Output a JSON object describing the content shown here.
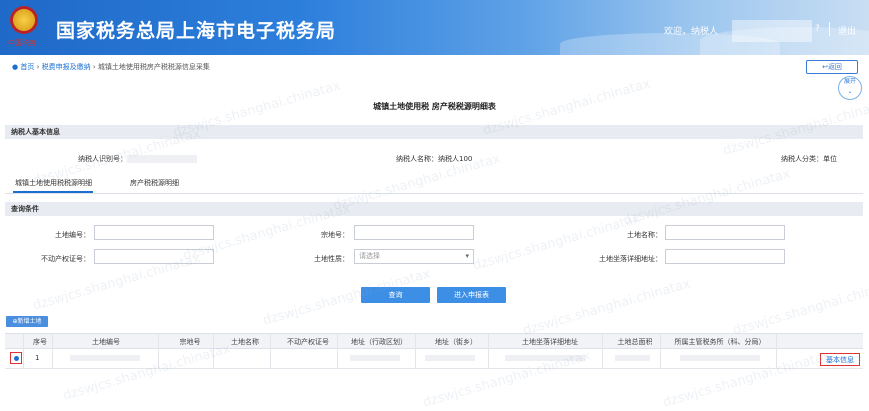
{
  "header": {
    "title": "国家税务总局上海市电子税务局",
    "emblem_caption": "中国税务",
    "greeting": "欢迎，纳税人",
    "help": "?",
    "logout": "退出"
  },
  "breadcrumb": {
    "home": "首页",
    "sep1": "›",
    "level1": "税费申报及缴纳",
    "sep2": "›",
    "current": "城镇土地使用税房产税税源信息采集"
  },
  "actions": {
    "back": "返回",
    "expand": "展开"
  },
  "page_title": "城镇土地使用税 房产税税源明细表",
  "taxpayer": {
    "section_title": "纳税人基本信息",
    "id_label": "纳税人识别号：",
    "name_label": "纳税人名称：",
    "name_value": "纳税人100",
    "category_label": "纳税人分类：",
    "category_value": "单位"
  },
  "tabs": [
    {
      "label": "城镇土地使用税税源明细",
      "active": true
    },
    {
      "label": "房产税税源明细",
      "active": false
    }
  ],
  "query": {
    "section_title": "查询条件",
    "land_no_label": "土地编号：",
    "parcel_no_label": "宗地号：",
    "land_name_label": "土地名称：",
    "property_cert_label": "不动产权证号：",
    "land_nature_label": "土地性质：",
    "land_nature_placeholder": "请选择",
    "land_address_label": "土地坐落详细地址：",
    "query_button": "查询",
    "declare_button": "进入申报表"
  },
  "table": {
    "add_button": "新增土地",
    "columns": [
      "序号",
      "土地编号",
      "宗地号",
      "土地名称",
      "不动产权证号",
      "地址（行政区划）",
      "地址（街乡）",
      "土地坐落详细地址",
      "土地总面积",
      "所属主管税务所（科、分局）"
    ],
    "rows": [
      {
        "index": "1"
      }
    ],
    "detail_button": "基本信息"
  },
  "watermark": "dzswjcs.shanghai.chinatax",
  "colors": {
    "header_blue": "#1f69c8",
    "accent": "#3d8fe6",
    "highlight_red": "#dd3333"
  }
}
